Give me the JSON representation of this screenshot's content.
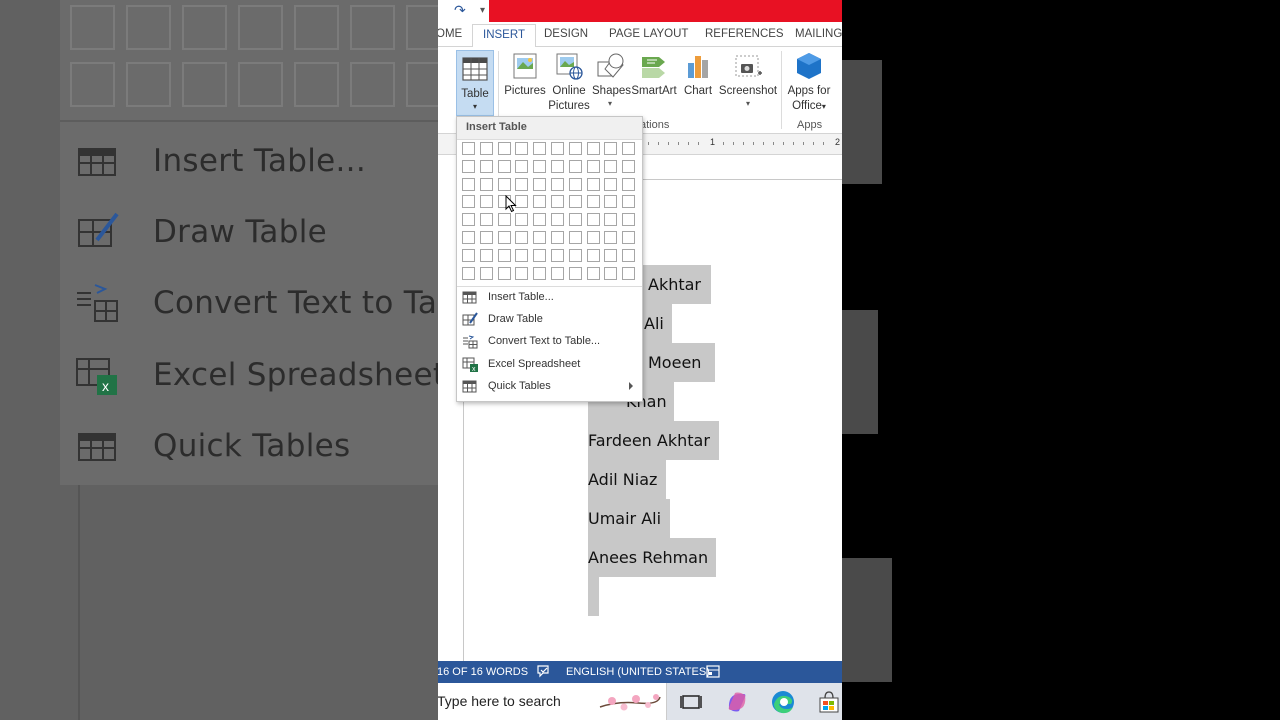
{
  "background_left": {
    "items": [
      {
        "label": "Insert Table...",
        "icon": "table-icon"
      },
      {
        "label": "Draw Table",
        "icon": "draw-table-icon"
      },
      {
        "label": "Convert Text to Ta",
        "icon": "convert-text-icon"
      },
      {
        "label": "Excel Spreadsheet",
        "icon": "excel-icon"
      },
      {
        "label": "Quick Tables",
        "icon": "table-icon"
      }
    ]
  },
  "quick_access": {
    "redo": "↷",
    "more": "▾"
  },
  "tabs": [
    {
      "label": "OME",
      "active": false
    },
    {
      "label": "INSERT",
      "active": true
    },
    {
      "label": "DESIGN",
      "active": false
    },
    {
      "label": "PAGE LAYOUT",
      "active": false
    },
    {
      "label": "REFERENCES",
      "active": false
    },
    {
      "label": "MAILINGS",
      "active": false
    }
  ],
  "ribbon": {
    "table": {
      "label": "Table",
      "arrow": "▾"
    },
    "pictures": {
      "label": "Pictures"
    },
    "online_pictures": {
      "label1": "Online",
      "label2": "Pictures"
    },
    "shapes": {
      "label": "Shapes",
      "arrow": "▾"
    },
    "smartart": {
      "label": "SmartArt"
    },
    "chart": {
      "label": "Chart"
    },
    "screenshot": {
      "label": "Screenshot",
      "arrow": "▾"
    },
    "apps_for_office": {
      "label1": "Apps for",
      "label2": "Office",
      "arrow": "▾"
    },
    "group_illustrations": "ations",
    "group_apps": "Apps"
  },
  "ruler": {
    "marks": [
      "1",
      "2"
    ]
  },
  "dropdown": {
    "header": "Insert Table",
    "grid": {
      "columns": 10,
      "rows": 8
    },
    "items": [
      {
        "label": "Insert Table...",
        "icon": "table-icon",
        "submenu": false
      },
      {
        "label": "Draw Table",
        "icon": "draw-table-icon",
        "submenu": false
      },
      {
        "label": "Convert Text to Table...",
        "icon": "convert-text-icon",
        "submenu": false
      },
      {
        "label": "Excel Spreadsheet",
        "icon": "excel-icon",
        "submenu": false
      },
      {
        "label": "Quick Tables",
        "icon": "table-icon",
        "submenu": true
      }
    ]
  },
  "document": {
    "lines": [
      {
        "text": "Akhtar"
      },
      {
        "text": "Ali"
      },
      {
        "text": "Moeen"
      },
      {
        "text": "Khan"
      },
      {
        "text": "Fardeen Akhtar"
      },
      {
        "text": "Adil Niaz"
      },
      {
        "text": "Umair Ali"
      },
      {
        "text": "Anees Rehman"
      },
      {
        "text": ""
      }
    ]
  },
  "statusbar": {
    "words": "16 OF 16 WORDS",
    "language": "ENGLISH (UNITED STATES)"
  },
  "taskbar": {
    "search_placeholder": "Type here to search"
  },
  "colors": {
    "accent": "#2b579a",
    "titlebar_red": "#e81123",
    "selection": "#c8c8c8"
  }
}
